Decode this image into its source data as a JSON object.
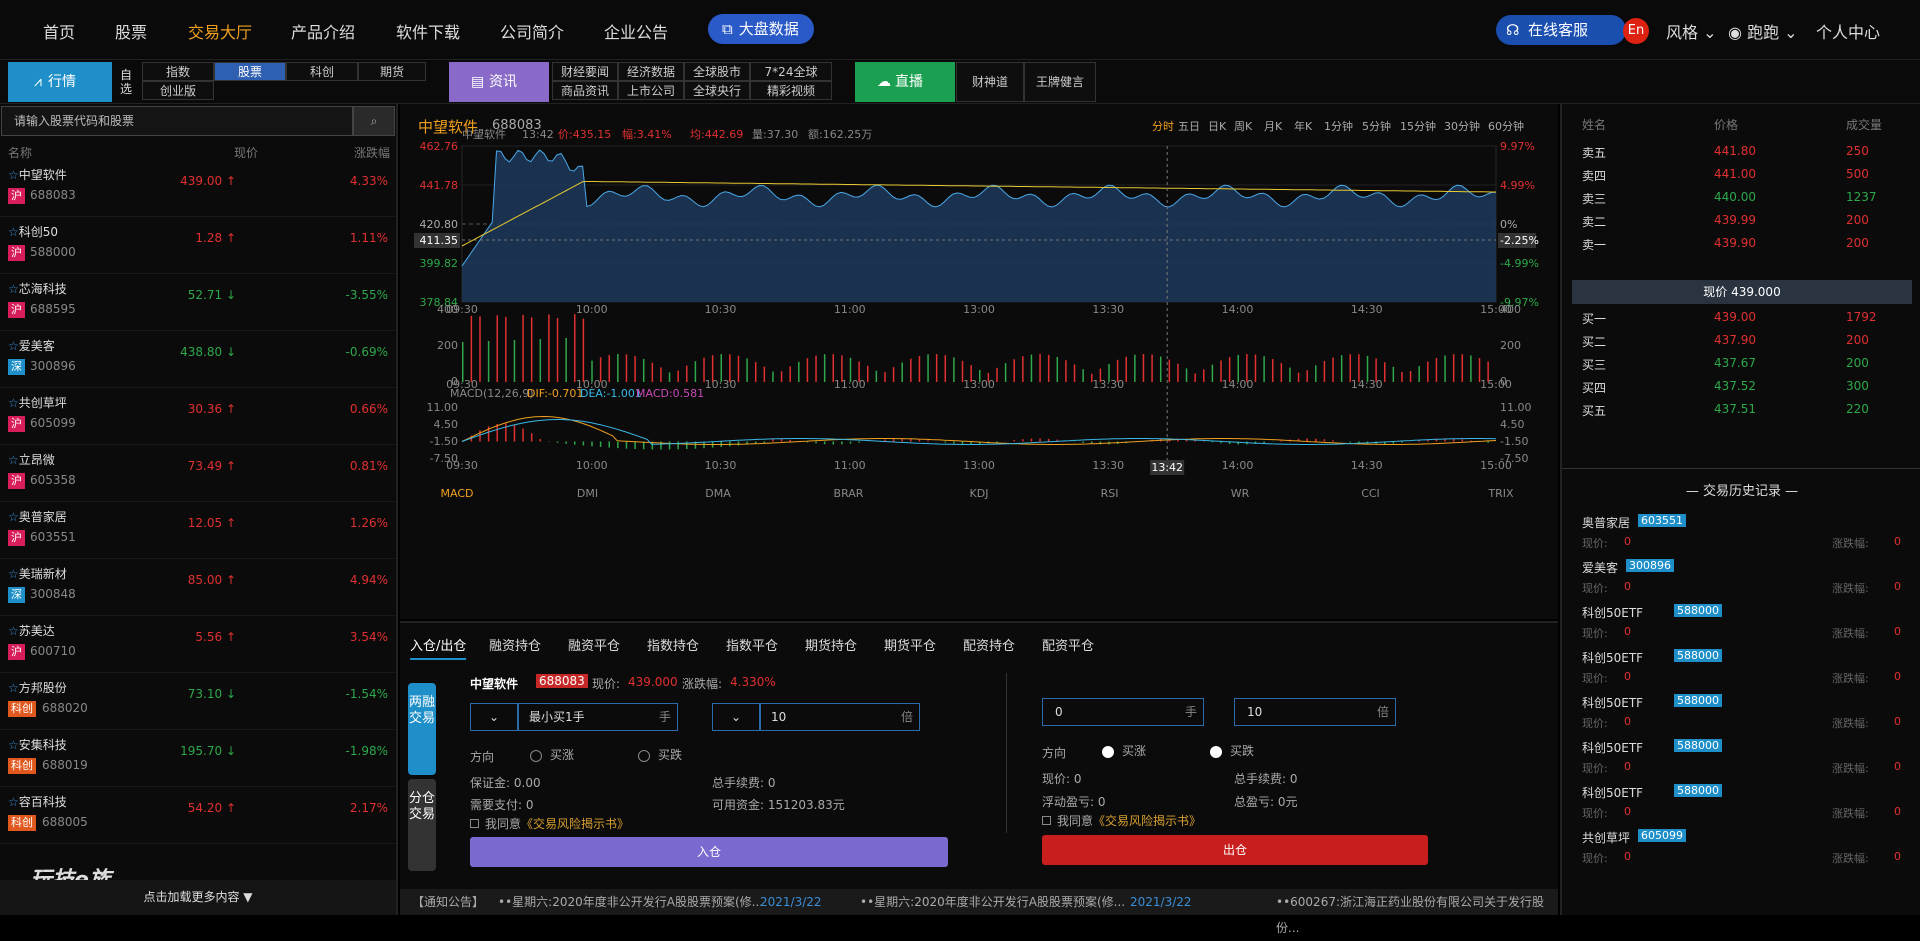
{
  "nav": {
    "items": [
      "首页",
      "股票",
      "交易大厅",
      "产品介绍",
      "软件下载",
      "公司简介",
      "企业公告"
    ],
    "active": "交易大厅",
    "bigdata": "大盘数据",
    "kefu": "在线客服",
    "en": "En",
    "style": "风格",
    "user": "跑跑",
    "center": "个人中心"
  },
  "sub": {
    "hangqing": "行情",
    "zixuan": "自选",
    "r1": [
      "指数",
      "股票",
      "科创",
      "期货"
    ],
    "chuangye": "创业版",
    "zixun": "资讯",
    "news": [
      "财经要闻",
      "经济数据",
      "全球股市",
      "7*24全球",
      "商品资讯",
      "上市公司",
      "全球央行",
      "精彩视频"
    ],
    "live": "直播",
    "live_items": [
      "财神道",
      "王牌健言"
    ]
  },
  "left": {
    "search_placeholder": "请输入股票代码和股票",
    "h_name": "名称",
    "h_price": "现价",
    "h_pct": "涨跌幅",
    "stocks": [
      {
        "name": "中望软件",
        "badge": "沪",
        "code": "688083",
        "price": "439.00",
        "pct": "4.33%",
        "dir": "up"
      },
      {
        "name": "科创50",
        "badge": "沪",
        "code": "588000",
        "price": "1.28",
        "pct": "1.11%",
        "dir": "up"
      },
      {
        "name": "芯海科技",
        "badge": "沪",
        "code": "688595",
        "price": "52.71",
        "pct": "-3.55%",
        "dir": "dn"
      },
      {
        "name": "爱美客",
        "badge": "深",
        "code": "300896",
        "price": "438.80",
        "pct": "-0.69%",
        "dir": "dn"
      },
      {
        "name": "共创草坪",
        "badge": "沪",
        "code": "605099",
        "price": "30.36",
        "pct": "0.66%",
        "dir": "up"
      },
      {
        "name": "立昂微",
        "badge": "沪",
        "code": "605358",
        "price": "73.49",
        "pct": "0.81%",
        "dir": "up"
      },
      {
        "name": "奥普家居",
        "badge": "沪",
        "code": "603551",
        "price": "12.05",
        "pct": "1.26%",
        "dir": "up"
      },
      {
        "name": "美瑞新材",
        "badge": "深",
        "code": "300848",
        "price": "85.00",
        "pct": "4.94%",
        "dir": "up"
      },
      {
        "name": "苏美达",
        "badge": "沪",
        "code": "600710",
        "price": "5.56",
        "pct": "3.54%",
        "dir": "up"
      },
      {
        "name": "方邦股份",
        "badge": "科创",
        "code": "688020",
        "price": "73.10",
        "pct": "-1.54%",
        "dir": "dn"
      },
      {
        "name": "安集科技",
        "badge": "科创",
        "code": "688019",
        "price": "195.70",
        "pct": "-1.98%",
        "dir": "dn"
      },
      {
        "name": "容百科技",
        "badge": "科创",
        "code": "688005",
        "price": "54.20",
        "pct": "2.17%",
        "dir": "up"
      }
    ],
    "logo": "玩技e族",
    "loadmore": "点击加载更多内容"
  },
  "chart": {
    "name": "中望软件",
    "code": "688083",
    "periods": [
      "分时",
      "五日",
      "日K",
      "周K",
      "月K",
      "年K",
      "1分钟",
      "5分钟",
      "15分钟",
      "30分钟",
      "60分钟"
    ],
    "info": {
      "name": "中望软件",
      "time": "13:42",
      "price": "价:435.15",
      "amp": "幅:3.41%",
      "avg": "均:442.69",
      "vol": "量:37.30",
      "amt": "额:162.25万"
    },
    "yleft": [
      "462.76",
      "441.78",
      "420.80",
      "399.82",
      "378.84"
    ],
    "yright": [
      "9.97%",
      "4.99%",
      "0%",
      "-4.99%",
      "-9.97%"
    ],
    "cross_left": "411.35",
    "cross_right": "-2.25%",
    "times": [
      "09:30",
      "10:00",
      "10:30",
      "11:00",
      "13:00",
      "13:30",
      "14:00",
      "14:30",
      "15:00"
    ],
    "vol_ticks": [
      "400",
      "200",
      "0"
    ],
    "macd_label": {
      "t": "MACD(12,26,9)",
      "dif": "DIF:-0.701",
      "dea": "DEA:-1.001",
      "macd": "MACD:0.581"
    },
    "macd_ticks": [
      "11.00",
      "4.50",
      "-1.50",
      "-7.50"
    ],
    "cross_time": "13:42",
    "indicators": [
      "MACD",
      "DMI",
      "DMA",
      "BRAR",
      "KDJ",
      "RSI",
      "WR",
      "CCI",
      "TRIX"
    ]
  },
  "chart_data": {
    "type": "line",
    "title": "中望软件 688083",
    "x": [
      "09:30",
      "10:00",
      "10:30",
      "11:00",
      "13:00",
      "13:30",
      "14:00",
      "14:30",
      "15:00"
    ],
    "series": [],
    "ylim": [
      378.84,
      462.76
    ]
  },
  "orderbook": {
    "h": [
      "姓名",
      "价格",
      "成交量"
    ],
    "sell": [
      [
        "卖五",
        "441.80",
        "250"
      ],
      [
        "卖四",
        "441.00",
        "500"
      ],
      [
        "卖三",
        "440.00",
        "1237"
      ],
      [
        "卖二",
        "439.99",
        "200"
      ],
      [
        "卖一",
        "439.90",
        "200"
      ]
    ],
    "now": "现价 439.000",
    "buy": [
      [
        "买一",
        "439.00",
        "1792"
      ],
      [
        "买二",
        "437.90",
        "200"
      ],
      [
        "买三",
        "437.67",
        "200"
      ],
      [
        "买四",
        "437.52",
        "300"
      ],
      [
        "买五",
        "437.51",
        "220"
      ]
    ]
  },
  "history": {
    "title": "交易历史记录",
    "now_lbl": "现价:",
    "pct_lbl": "涨跌幅:",
    "zero": "0",
    "items": [
      {
        "name": "奥普家居",
        "code": "603551"
      },
      {
        "name": "爱美客",
        "code": "300896"
      },
      {
        "name": "科创50ETF",
        "code": "588000"
      },
      {
        "name": "科创50ETF",
        "code": "588000"
      },
      {
        "name": "科创50ETF",
        "code": "588000"
      },
      {
        "name": "科创50ETF",
        "code": "588000"
      },
      {
        "name": "科创50ETF",
        "code": "588000"
      },
      {
        "name": "共创草坪",
        "code": "605099"
      }
    ]
  },
  "trade": {
    "tabs": [
      "入仓/出仓",
      "融资持仓",
      "融资平仓",
      "指数持仓",
      "指数平仓",
      "期货持仓",
      "期货平仓",
      "配资持仓",
      "配资平仓"
    ],
    "side1": "两融交易",
    "side2": "分仓交易",
    "stock": "中望软件",
    "code": "688083",
    "price_lbl": "现价:",
    "price": "439.000",
    "pct_lbl": "涨跌幅:",
    "pct": "4.330%",
    "min_buy": "最小买1手",
    "hand": "手",
    "qty": "10",
    "bei": "倍",
    "dir": "方向",
    "up": "买涨",
    "down": "买跌",
    "margin": "保证金:",
    "margin_v": "0.00",
    "fee": "总手续费:",
    "fee_v": "0",
    "need": "需要支付:",
    "need_v": "0",
    "avail": "可用资金:",
    "avail_v": "151203.83元",
    "agree": "我同意",
    "risk": "《交易风险揭示书》",
    "in_btn": "入仓",
    "r_qty": "0",
    "r_bei_v": "10",
    "now2": "现价:",
    "now2_v": "0",
    "fee2": "总手续费:",
    "fee2_v": "0",
    "float": "浮动盈亏:",
    "float_v": "0",
    "total": "总盈亏:",
    "total_v": "0元",
    "out_btn": "出仓"
  },
  "ticker": {
    "label": "【通知公告】",
    "n1": "••星期六:2020年度非公开发行A股股票预案(修...",
    "d1": "2021/3/22",
    "n2": "••星期六:2020年度非公开发行A股股票预案(修...",
    "d2": "2021/3/22",
    "n3": "••600267:浙江海正药业股份有限公司关于发行股份..."
  }
}
